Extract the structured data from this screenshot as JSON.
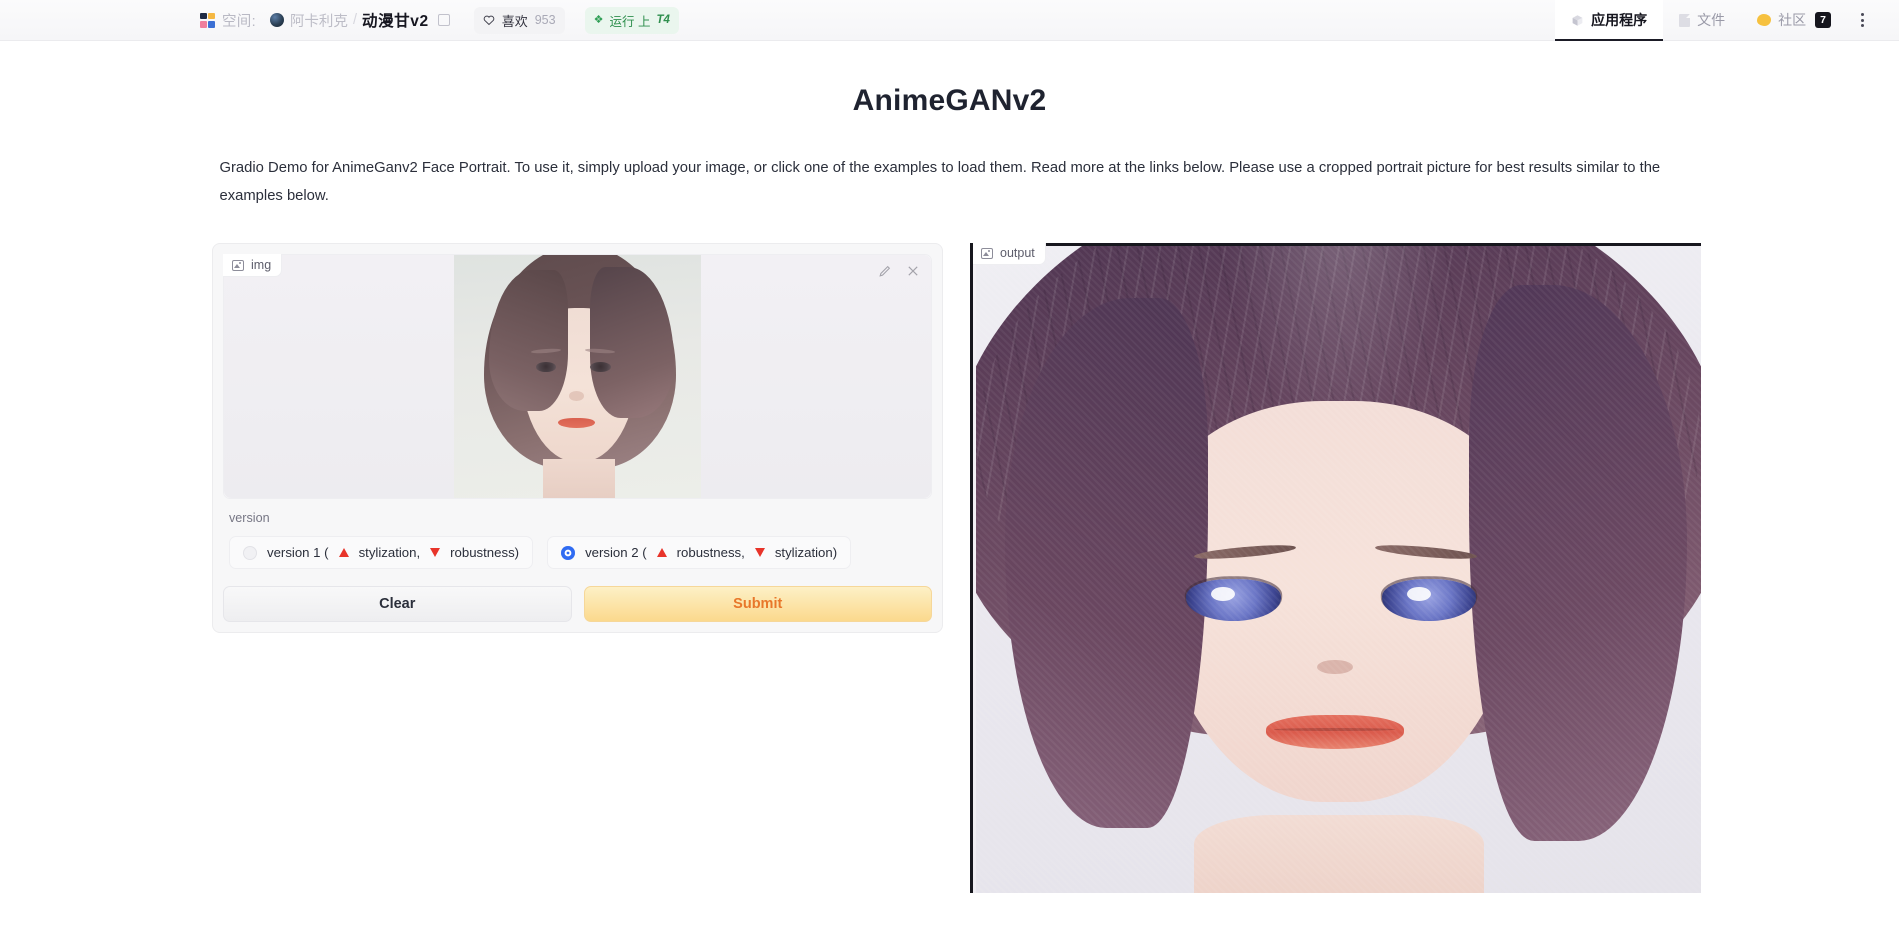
{
  "header": {
    "spaces_icon": "spaces-grid-icon",
    "spaces_label": "空间:",
    "author": "阿卡利克",
    "separator": "/",
    "space_title": "动漫甘v2",
    "copy_icon": "copy-icon",
    "like": {
      "icon": "heart-icon",
      "label": "喜欢",
      "count": "953"
    },
    "runtime": {
      "icon": "sparkle-icon",
      "label": "运行 上",
      "hardware": "T4"
    },
    "tabs": [
      {
        "label": "应用程序",
        "icon": "cube-icon",
        "active": true
      },
      {
        "label": "文件",
        "icon": "file-icon",
        "active": false
      },
      {
        "label": "社区",
        "icon": "blob-icon",
        "active": false,
        "badge": "7"
      }
    ],
    "overflow_icon": "three-dots-vertical-icon"
  },
  "main": {
    "title": "AnimeGANv2",
    "description": "Gradio Demo for AnimeGanv2 Face Portrait. To use it, simply upload your image, or click one of the examples to load them. Read more at the links below. Please use a cropped portrait picture for best results similar to the examples below."
  },
  "input_panel": {
    "label": "img",
    "label_icon": "image-icon",
    "edit_icon": "pencil-icon",
    "clear_icon": "close-x-icon",
    "image_alt": "uploaded portrait photo of a woman"
  },
  "radio": {
    "title": "version",
    "options": [
      {
        "prefix": "version 1 (",
        "up_label": " stylization, ",
        "down_label": " robustness)",
        "selected": false
      },
      {
        "prefix": "version 2 (",
        "up_label": " robustness, ",
        "down_label": " stylization)",
        "selected": true
      }
    ]
  },
  "buttons": {
    "clear": "Clear",
    "submit": "Submit"
  },
  "output_panel": {
    "label": "output",
    "label_icon": "image-icon",
    "image_alt": "anime stylized portrait result"
  },
  "colors": {
    "accent_blue": "#2f6bf2",
    "submit_text": "#e8772a",
    "submit_bg": "#fbd98d",
    "triangle_red": "#e8342a",
    "running_green": "#2f8f4e",
    "badge_dark": "#16161e"
  }
}
